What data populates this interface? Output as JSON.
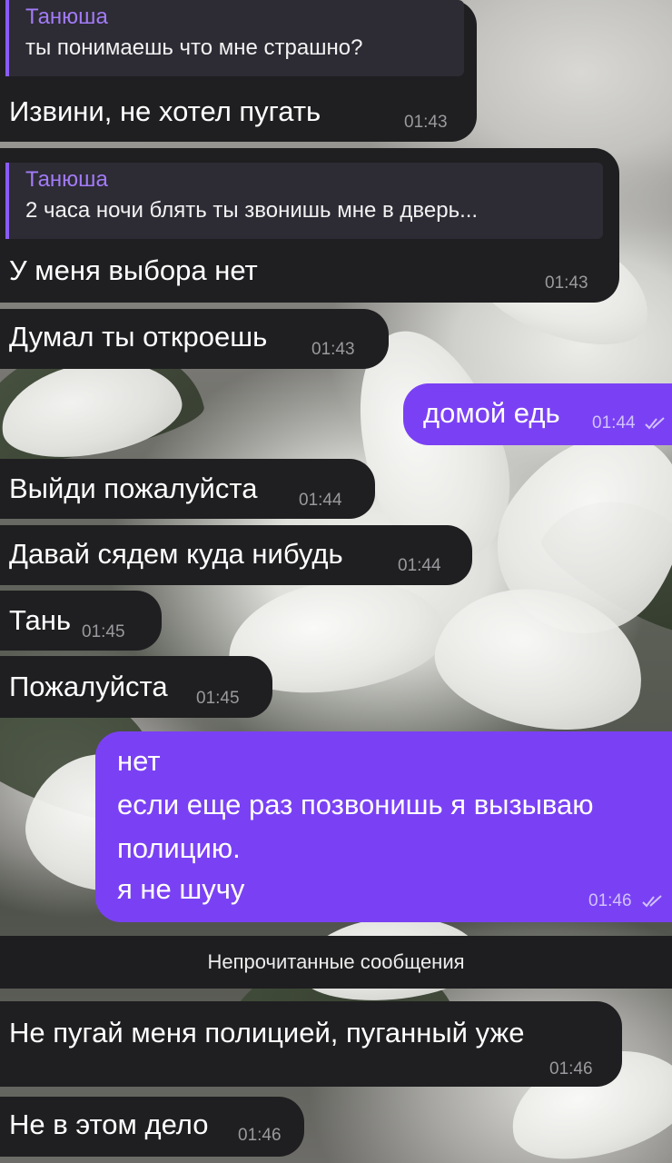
{
  "messages": [
    {
      "direction": "incoming",
      "reply": {
        "name": "Танюша",
        "text": "ты понимаешь что мне страшно?"
      },
      "text": "Извини, не хотел пугать",
      "time": "01:43"
    },
    {
      "direction": "incoming",
      "reply": {
        "name": "Танюша",
        "text": "2 часа ночи блять ты звонишь мне в дверь..."
      },
      "text": "У меня выбора нет",
      "time": "01:43"
    },
    {
      "direction": "incoming",
      "text": "Думал ты откроешь",
      "time": "01:43"
    },
    {
      "direction": "outgoing",
      "text": "домой едь",
      "time": "01:44",
      "status": "read"
    },
    {
      "direction": "incoming",
      "text": "Выйди пожалуйста",
      "time": "01:44"
    },
    {
      "direction": "incoming",
      "text": "Давай сядем куда нибудь",
      "time": "01:44"
    },
    {
      "direction": "incoming",
      "text": "Тань",
      "time": "01:45"
    },
    {
      "direction": "incoming",
      "text": "Пожалуйста",
      "time": "01:45"
    },
    {
      "direction": "outgoing",
      "lines": [
        "нет",
        "если еще раз позвонишь я вызываю",
        "полицию.",
        "я не шучу"
      ],
      "time": "01:46",
      "status": "read"
    },
    {
      "direction": "incoming",
      "text": "Не пугай меня полицией, пуганный уже",
      "time": "01:46"
    },
    {
      "direction": "incoming",
      "text": "Не в этом дело",
      "time": "01:46"
    }
  ],
  "unread_divider": "Непрочитанные сообщения",
  "colors": {
    "incoming_bubble": "#1f1f21",
    "outgoing_bubble": "#7a41f4",
    "reply_accent": "#8a5cf6",
    "time_incoming": "#9a9a9e",
    "time_outgoing": "#d2c2ff"
  },
  "icons": {
    "read_status": "double-check-icon"
  }
}
